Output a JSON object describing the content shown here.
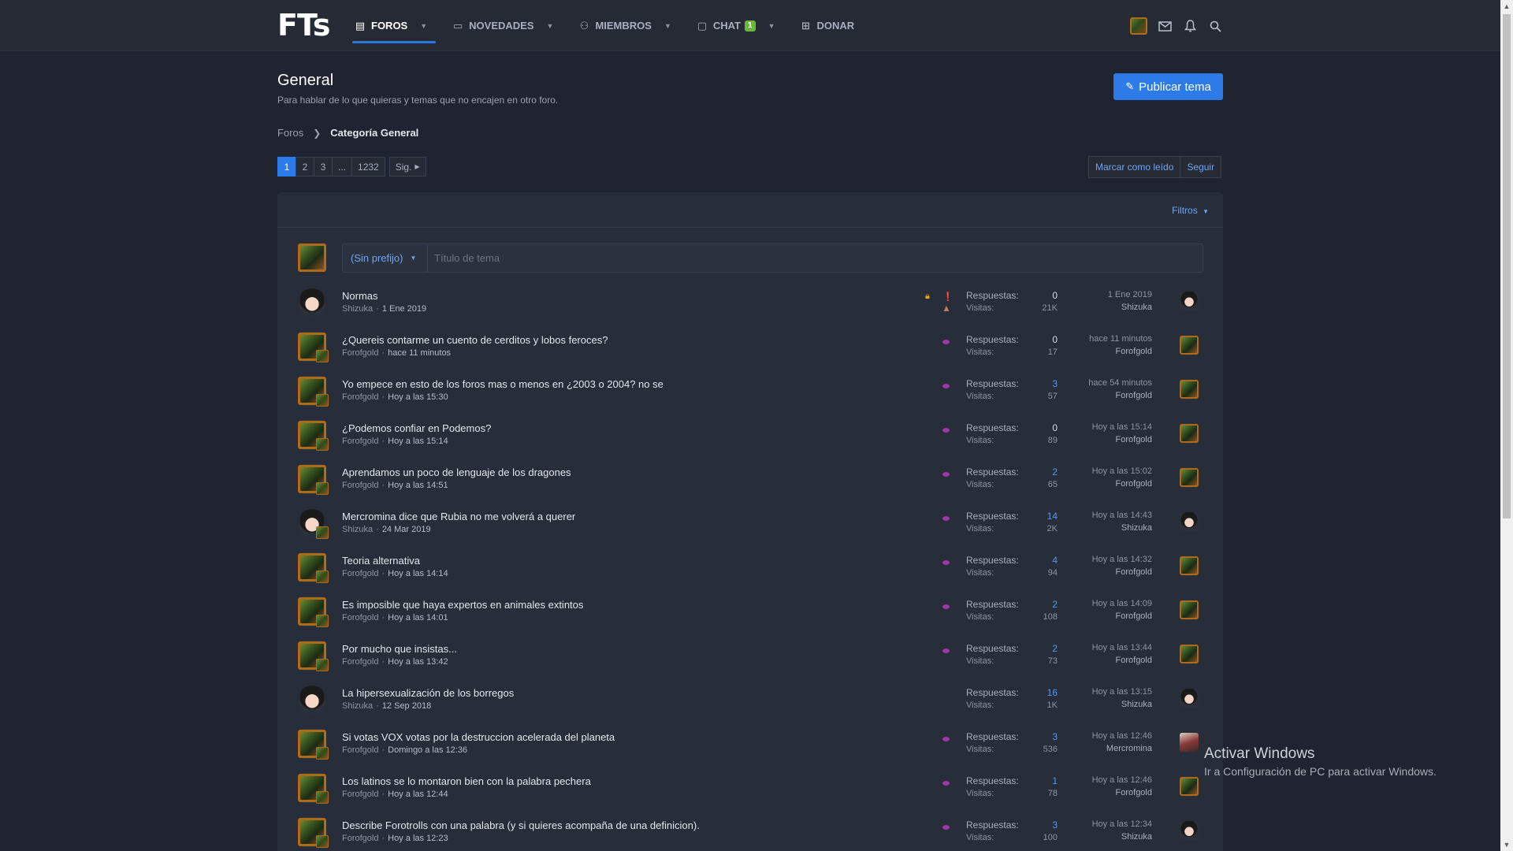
{
  "brand": {
    "logo": "FTs"
  },
  "nav": {
    "items": [
      {
        "label": "FOROS",
        "icon": "forum-icon",
        "active": true,
        "caret": true
      },
      {
        "label": "NOVEDADES",
        "icon": "news-icon",
        "active": false,
        "caret": true
      },
      {
        "label": "MIEMBROS",
        "icon": "members-icon",
        "active": false,
        "caret": true
      },
      {
        "label": "CHAT",
        "icon": "chat-icon",
        "active": false,
        "caret": true,
        "badge": "1"
      },
      {
        "label": "DONAR",
        "icon": "gift-icon",
        "active": false,
        "caret": false
      }
    ],
    "right_icons": [
      "user-avatar",
      "mail-icon",
      "bell-icon",
      "search-icon"
    ]
  },
  "header": {
    "title": "General",
    "description": "Para hablar de lo que quieras y temas que no encajen en otro foro.",
    "post_button": "Publicar tema"
  },
  "breadcrumb": {
    "root": "Foros",
    "current": "Categoría General"
  },
  "pagination": {
    "pages": [
      "1",
      "2",
      "3",
      "...",
      "1232"
    ],
    "active": "1",
    "next": "Sig."
  },
  "actions": {
    "mark_read": "Marcar como leído",
    "follow": "Seguir"
  },
  "filters": {
    "label": "Filtros"
  },
  "new_thread": {
    "prefix": "(Sin prefijo)",
    "placeholder": "Título de tema"
  },
  "threads": [
    {
      "title": "Normas",
      "author": "Shizuka",
      "date": "1 Ene 2019",
      "avatar": "shizuka",
      "mini": false,
      "locked": true,
      "sticky": true,
      "replies": "0",
      "replies_link": false,
      "views": "21K",
      "last_date": "1 Ene 2019",
      "last_user": "Shizuka",
      "last_avatar": "shizuka"
    },
    {
      "title": "¿Quereis contarme un cuento de cerditos y lobos feroces?",
      "author": "Forofgold",
      "date": "hace 11 minutos",
      "avatar": "forof",
      "mini": true,
      "replies": "0",
      "replies_link": false,
      "views": "17",
      "last_date": "hace 11 minutos",
      "last_user": "Forofgold",
      "last_avatar": "forof"
    },
    {
      "title": "Yo empece en esto de los foros mas o menos en ¿2003 o 2004? no se",
      "author": "Forofgold",
      "date": "Hoy a las 15:30",
      "avatar": "forof",
      "mini": true,
      "replies": "3",
      "replies_link": true,
      "views": "57",
      "last_date": "hace 54 minutos",
      "last_user": "Forofgold",
      "last_avatar": "forof"
    },
    {
      "title": "¿Podemos confiar en Podemos?",
      "author": "Forofgold",
      "date": "Hoy a las 15:14",
      "avatar": "forof",
      "mini": true,
      "replies": "0",
      "replies_link": false,
      "views": "89",
      "last_date": "Hoy a las 15:14",
      "last_user": "Forofgold",
      "last_avatar": "forof"
    },
    {
      "title": "Aprendamos un poco de lenguaje de los dragones",
      "author": "Forofgold",
      "date": "Hoy a las 14:51",
      "avatar": "forof",
      "mini": true,
      "replies": "2",
      "replies_link": true,
      "views": "65",
      "last_date": "Hoy a las 15:02",
      "last_user": "Forofgold",
      "last_avatar": "forof"
    },
    {
      "title": "Mercromina dice que Rubia no me volverá a querer",
      "author": "Shizuka",
      "date": "24 Mar 2019",
      "avatar": "shizuka",
      "mini": true,
      "replies": "14",
      "replies_link": true,
      "views": "2K",
      "last_date": "Hoy a las 14:43",
      "last_user": "Shizuka",
      "last_avatar": "shizuka"
    },
    {
      "title": "Teoria alternativa",
      "author": "Forofgold",
      "date": "Hoy a las 14:14",
      "avatar": "forof",
      "mini": true,
      "replies": "4",
      "replies_link": true,
      "views": "94",
      "last_date": "Hoy a las 14:32",
      "last_user": "Forofgold",
      "last_avatar": "forof"
    },
    {
      "title": "Es imposible que haya expertos en animales extintos",
      "author": "Forofgold",
      "date": "Hoy a las 14:01",
      "avatar": "forof",
      "mini": true,
      "replies": "2",
      "replies_link": true,
      "views": "108",
      "last_date": "Hoy a las 14:09",
      "last_user": "Forofgold",
      "last_avatar": "forof"
    },
    {
      "title": "Por mucho que insistas...",
      "author": "Forofgold",
      "date": "Hoy a las 13:42",
      "avatar": "forof",
      "mini": true,
      "replies": "2",
      "replies_link": true,
      "views": "73",
      "last_date": "Hoy a las 13:44",
      "last_user": "Forofgold",
      "last_avatar": "forof"
    },
    {
      "title": "La hipersexualización de los borregos",
      "author": "Shizuka",
      "date": "12 Sep 2018",
      "avatar": "shizuka",
      "mini": false,
      "noeye": true,
      "replies": "16",
      "replies_link": true,
      "views": "1K",
      "last_date": "Hoy a las 13:15",
      "last_user": "Shizuka",
      "last_avatar": "shizuka"
    },
    {
      "title": "Si votas VOX votas por la destruccion acelerada del planeta",
      "author": "Forofgold",
      "date": "Domingo a las 12:36",
      "avatar": "forof",
      "mini": true,
      "replies": "3",
      "replies_link": true,
      "views": "536",
      "last_date": "Hoy a las 12:46",
      "last_user": "Mercromina",
      "last_avatar": "merc"
    },
    {
      "title": "Los latinos se lo montaron bien con la palabra pechera",
      "author": "Forofgold",
      "date": "Hoy a las 12:44",
      "avatar": "forof",
      "mini": true,
      "replies": "1",
      "replies_link": true,
      "views": "78",
      "last_date": "Hoy a las 12:46",
      "last_user": "Forofgold",
      "last_avatar": "forof"
    },
    {
      "title": "Describe Forotrolls con una palabra (y si quieres acompaña de una definicion).",
      "author": "Forofgold",
      "date": "Hoy a las 12:23",
      "avatar": "forof",
      "mini": true,
      "replies": "3",
      "replies_link": true,
      "views": "100",
      "last_date": "Hoy a las 12:34",
      "last_user": "Shizuka",
      "last_avatar": "shizuka"
    }
  ],
  "labels": {
    "replies": "Respuestas:",
    "views": "Visitas:",
    "meta_sep": "·"
  },
  "windows": {
    "title": "Activar Windows",
    "subtitle": "Ir a Configuración de PC para activar Windows."
  }
}
